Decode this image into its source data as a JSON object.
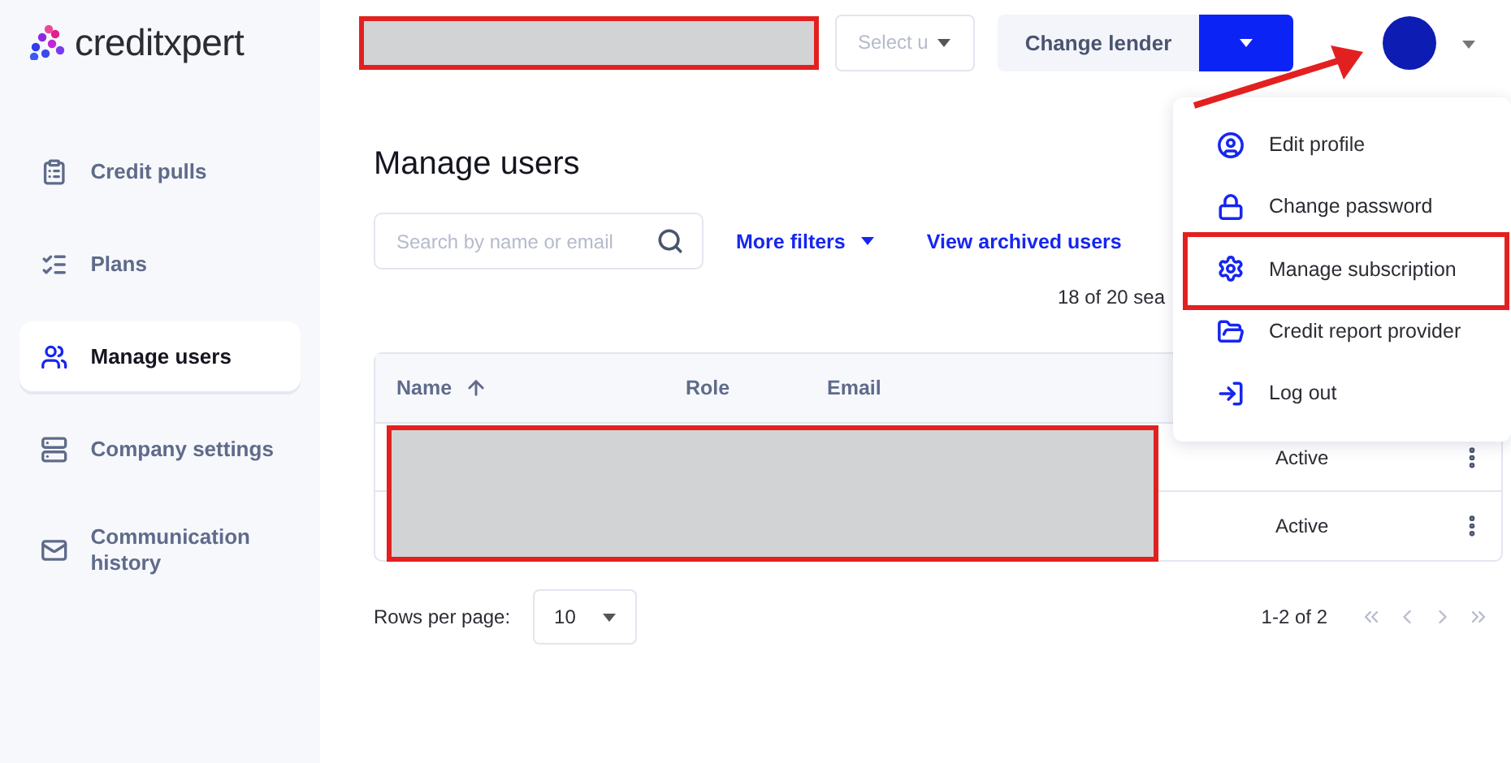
{
  "logo": {
    "text": "creditxpert"
  },
  "sidebar": {
    "items": [
      {
        "label": "Credit pulls",
        "selected": false
      },
      {
        "label": "Plans",
        "selected": false
      },
      {
        "label": "Manage users",
        "selected": true
      },
      {
        "label": "Company settings",
        "selected": false
      },
      {
        "label": "Communication history",
        "selected": false
      }
    ]
  },
  "topbar": {
    "select": {
      "placeholder": "Select u"
    },
    "lender_button": "Change lender"
  },
  "page": {
    "title": "Manage users",
    "search": {
      "placeholder": "Search by name or email"
    },
    "more_filters": "More filters",
    "archived_link": "View archived users",
    "result_count": "18 of 20 sea"
  },
  "table": {
    "columns": [
      {
        "label": "Name",
        "sorted": true
      },
      {
        "label": "Role",
        "sorted": false
      },
      {
        "label": "Email",
        "sorted": false
      }
    ],
    "rows": [
      {
        "status": "Active"
      },
      {
        "status": "Active"
      }
    ]
  },
  "pagination": {
    "rows_per_page_label": "Rows per page:",
    "rows_per_page": "10",
    "range": "1-2 of 2"
  },
  "user_menu": {
    "items": [
      {
        "label": "Edit profile"
      },
      {
        "label": "Change password"
      },
      {
        "label": "Manage subscription"
      },
      {
        "label": "Credit report provider"
      },
      {
        "label": "Log out"
      }
    ]
  }
}
